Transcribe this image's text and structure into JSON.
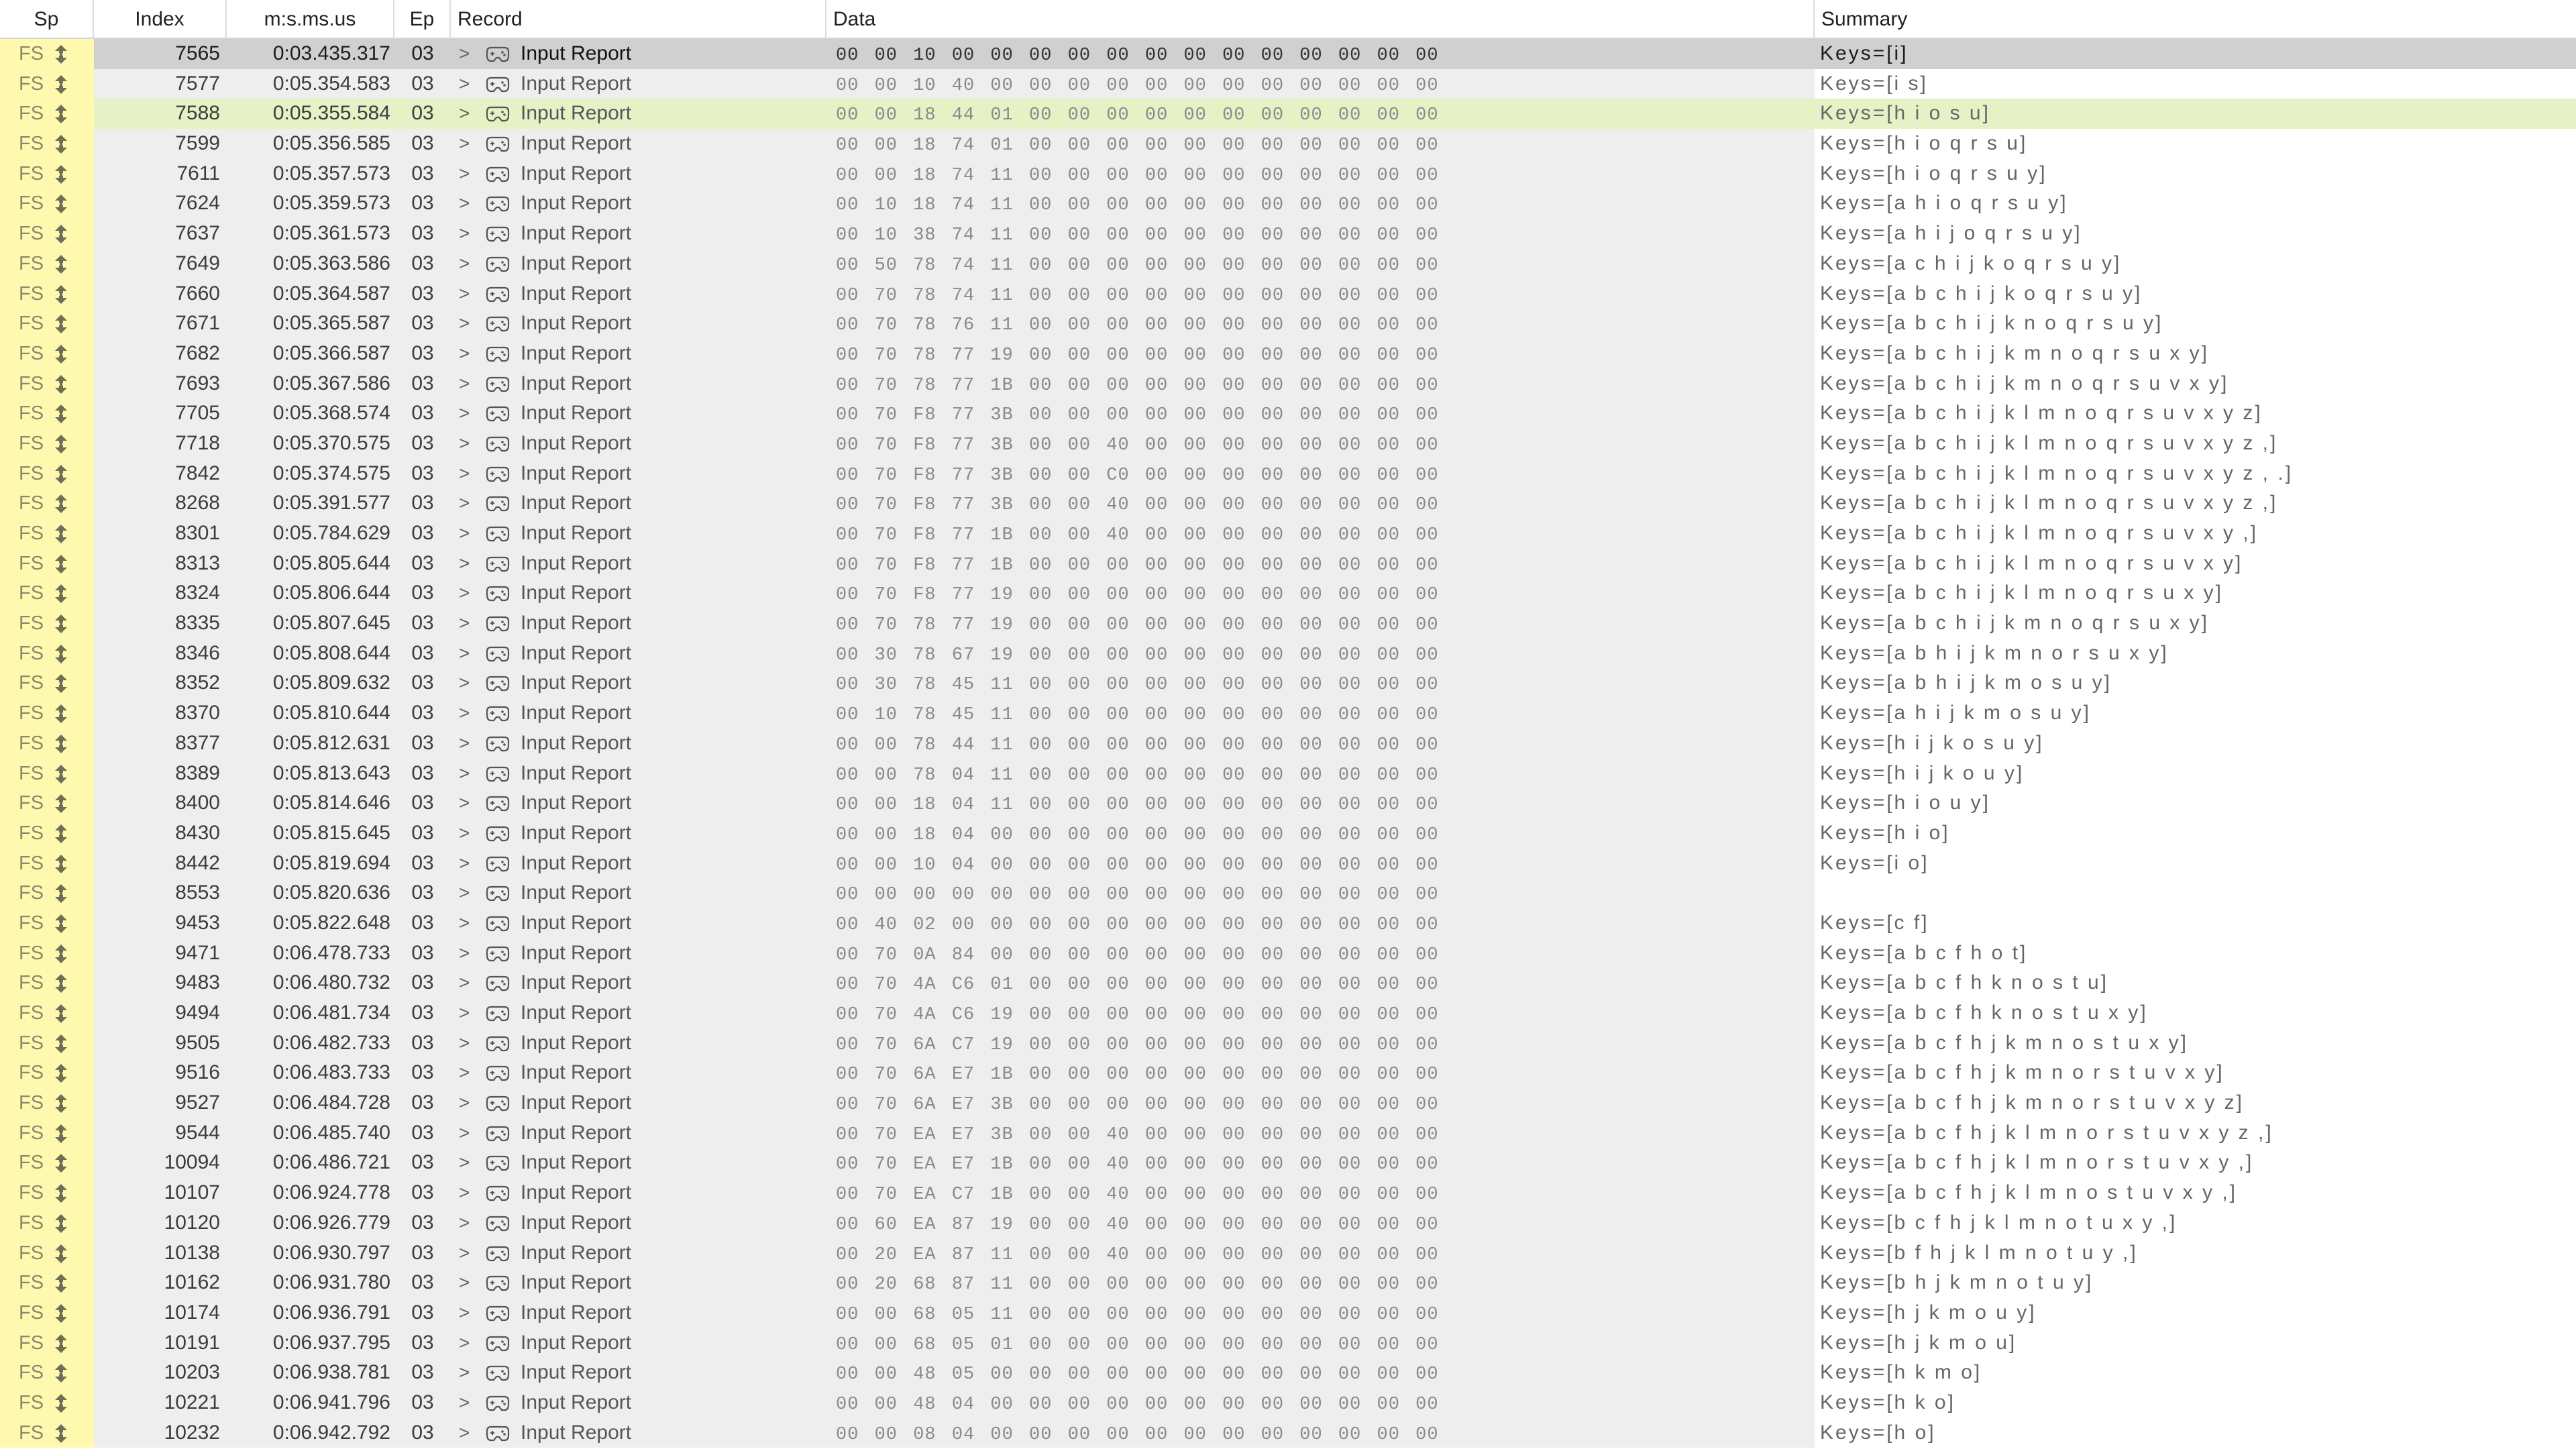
{
  "columns": {
    "sp": "Sp",
    "index": "Index",
    "time": "m:s.ms.us",
    "ep": "Ep",
    "record": "Record",
    "data": "Data",
    "summary": "Summary"
  },
  "icons": {
    "speed_arrow": "updown-arrow-icon",
    "expand": "chevron-right-icon",
    "record": "gamepad-icon"
  },
  "colors": {
    "sp_column": "#fff9b0",
    "selected_row": "#d0d0d0",
    "highlight_row": "#e6f2c6",
    "cell_bg": "#eeeeee"
  },
  "rows": [
    {
      "sp": "FS",
      "index": "7565",
      "time": "0:03.435.317",
      "ep": "03",
      "expand": ">",
      "record": "Input Report",
      "data": "00 00 10 00 00 00 00 00 00 00 00 00 00 00 00 00",
      "summary": "Keys=[i]",
      "state": "selected"
    },
    {
      "sp": "FS",
      "index": "7577",
      "time": "0:05.354.583",
      "ep": "03",
      "expand": ">",
      "record": "Input Report",
      "data": "00 00 10 40 00 00 00 00 00 00 00 00 00 00 00 00",
      "summary": "Keys=[i s]",
      "state": ""
    },
    {
      "sp": "FS",
      "index": "7588",
      "time": "0:05.355.584",
      "ep": "03",
      "expand": ">",
      "record": "Input Report",
      "data": "00 00 18 44 01 00 00 00 00 00 00 00 00 00 00 00",
      "summary": "Keys=[h i o s u]",
      "state": "highlight"
    },
    {
      "sp": "FS",
      "index": "7599",
      "time": "0:05.356.585",
      "ep": "03",
      "expand": ">",
      "record": "Input Report",
      "data": "00 00 18 74 01 00 00 00 00 00 00 00 00 00 00 00",
      "summary": "Keys=[h i o q r s u]",
      "state": ""
    },
    {
      "sp": "FS",
      "index": "7611",
      "time": "0:05.357.573",
      "ep": "03",
      "expand": ">",
      "record": "Input Report",
      "data": "00 00 18 74 11 00 00 00 00 00 00 00 00 00 00 00",
      "summary": "Keys=[h i o q r s u y]",
      "state": ""
    },
    {
      "sp": "FS",
      "index": "7624",
      "time": "0:05.359.573",
      "ep": "03",
      "expand": ">",
      "record": "Input Report",
      "data": "00 10 18 74 11 00 00 00 00 00 00 00 00 00 00 00",
      "summary": "Keys=[a h i o q r s u y]",
      "state": ""
    },
    {
      "sp": "FS",
      "index": "7637",
      "time": "0:05.361.573",
      "ep": "03",
      "expand": ">",
      "record": "Input Report",
      "data": "00 10 38 74 11 00 00 00 00 00 00 00 00 00 00 00",
      "summary": "Keys=[a h i j o q r s u y]",
      "state": ""
    },
    {
      "sp": "FS",
      "index": "7649",
      "time": "0:05.363.586",
      "ep": "03",
      "expand": ">",
      "record": "Input Report",
      "data": "00 50 78 74 11 00 00 00 00 00 00 00 00 00 00 00",
      "summary": "Keys=[a c h i j k o q r s u y]",
      "state": ""
    },
    {
      "sp": "FS",
      "index": "7660",
      "time": "0:05.364.587",
      "ep": "03",
      "expand": ">",
      "record": "Input Report",
      "data": "00 70 78 74 11 00 00 00 00 00 00 00 00 00 00 00",
      "summary": "Keys=[a b c h i j k o q r s u y]",
      "state": ""
    },
    {
      "sp": "FS",
      "index": "7671",
      "time": "0:05.365.587",
      "ep": "03",
      "expand": ">",
      "record": "Input Report",
      "data": "00 70 78 76 11 00 00 00 00 00 00 00 00 00 00 00",
      "summary": "Keys=[a b c h i j k n o q r s u y]",
      "state": ""
    },
    {
      "sp": "FS",
      "index": "7682",
      "time": "0:05.366.587",
      "ep": "03",
      "expand": ">",
      "record": "Input Report",
      "data": "00 70 78 77 19 00 00 00 00 00 00 00 00 00 00 00",
      "summary": "Keys=[a b c h i j k m n o q r s u x y]",
      "state": ""
    },
    {
      "sp": "FS",
      "index": "7693",
      "time": "0:05.367.586",
      "ep": "03",
      "expand": ">",
      "record": "Input Report",
      "data": "00 70 78 77 1B 00 00 00 00 00 00 00 00 00 00 00",
      "summary": "Keys=[a b c h i j k m n o q r s u v x y]",
      "state": ""
    },
    {
      "sp": "FS",
      "index": "7705",
      "time": "0:05.368.574",
      "ep": "03",
      "expand": ">",
      "record": "Input Report",
      "data": "00 70 F8 77 3B 00 00 00 00 00 00 00 00 00 00 00",
      "summary": "Keys=[a b c h i j k l m n o q r s u v x y z]",
      "state": ""
    },
    {
      "sp": "FS",
      "index": "7718",
      "time": "0:05.370.575",
      "ep": "03",
      "expand": ">",
      "record": "Input Report",
      "data": "00 70 F8 77 3B 00 00 40 00 00 00 00 00 00 00 00",
      "summary": "Keys=[a b c h i j k l m n o q r s u v x y z ,]",
      "state": ""
    },
    {
      "sp": "FS",
      "index": "7842",
      "time": "0:05.374.575",
      "ep": "03",
      "expand": ">",
      "record": "Input Report",
      "data": "00 70 F8 77 3B 00 00 C0 00 00 00 00 00 00 00 00",
      "summary": "Keys=[a b c h i j k l m n o q r s u v x y z , .]",
      "state": ""
    },
    {
      "sp": "FS",
      "index": "8268",
      "time": "0:05.391.577",
      "ep": "03",
      "expand": ">",
      "record": "Input Report",
      "data": "00 70 F8 77 3B 00 00 40 00 00 00 00 00 00 00 00",
      "summary": "Keys=[a b c h i j k l m n o q r s u v x y z ,]",
      "state": ""
    },
    {
      "sp": "FS",
      "index": "8301",
      "time": "0:05.784.629",
      "ep": "03",
      "expand": ">",
      "record": "Input Report",
      "data": "00 70 F8 77 1B 00 00 40 00 00 00 00 00 00 00 00",
      "summary": "Keys=[a b c h i j k l m n o q r s u v x y ,]",
      "state": ""
    },
    {
      "sp": "FS",
      "index": "8313",
      "time": "0:05.805.644",
      "ep": "03",
      "expand": ">",
      "record": "Input Report",
      "data": "00 70 F8 77 1B 00 00 00 00 00 00 00 00 00 00 00",
      "summary": "Keys=[a b c h i j k l m n o q r s u v x y]",
      "state": ""
    },
    {
      "sp": "FS",
      "index": "8324",
      "time": "0:05.806.644",
      "ep": "03",
      "expand": ">",
      "record": "Input Report",
      "data": "00 70 F8 77 19 00 00 00 00 00 00 00 00 00 00 00",
      "summary": "Keys=[a b c h i j k l m n o q r s u x y]",
      "state": ""
    },
    {
      "sp": "FS",
      "index": "8335",
      "time": "0:05.807.645",
      "ep": "03",
      "expand": ">",
      "record": "Input Report",
      "data": "00 70 78 77 19 00 00 00 00 00 00 00 00 00 00 00",
      "summary": "Keys=[a b c h i j k m n o q r s u x y]",
      "state": ""
    },
    {
      "sp": "FS",
      "index": "8346",
      "time": "0:05.808.644",
      "ep": "03",
      "expand": ">",
      "record": "Input Report",
      "data": "00 30 78 67 19 00 00 00 00 00 00 00 00 00 00 00",
      "summary": "Keys=[a b h i j k m n o r s u x y]",
      "state": ""
    },
    {
      "sp": "FS",
      "index": "8352",
      "time": "0:05.809.632",
      "ep": "03",
      "expand": ">",
      "record": "Input Report",
      "data": "00 30 78 45 11 00 00 00 00 00 00 00 00 00 00 00",
      "summary": "Keys=[a b h i j k m o s u y]",
      "state": ""
    },
    {
      "sp": "FS",
      "index": "8370",
      "time": "0:05.810.644",
      "ep": "03",
      "expand": ">",
      "record": "Input Report",
      "data": "00 10 78 45 11 00 00 00 00 00 00 00 00 00 00 00",
      "summary": "Keys=[a h i j k m o s u y]",
      "state": ""
    },
    {
      "sp": "FS",
      "index": "8377",
      "time": "0:05.812.631",
      "ep": "03",
      "expand": ">",
      "record": "Input Report",
      "data": "00 00 78 44 11 00 00 00 00 00 00 00 00 00 00 00",
      "summary": "Keys=[h i j k o s u y]",
      "state": ""
    },
    {
      "sp": "FS",
      "index": "8389",
      "time": "0:05.813.643",
      "ep": "03",
      "expand": ">",
      "record": "Input Report",
      "data": "00 00 78 04 11 00 00 00 00 00 00 00 00 00 00 00",
      "summary": "Keys=[h i j k o u y]",
      "state": ""
    },
    {
      "sp": "FS",
      "index": "8400",
      "time": "0:05.814.646",
      "ep": "03",
      "expand": ">",
      "record": "Input Report",
      "data": "00 00 18 04 11 00 00 00 00 00 00 00 00 00 00 00",
      "summary": "Keys=[h i o u y]",
      "state": ""
    },
    {
      "sp": "FS",
      "index": "8430",
      "time": "0:05.815.645",
      "ep": "03",
      "expand": ">",
      "record": "Input Report",
      "data": "00 00 18 04 00 00 00 00 00 00 00 00 00 00 00 00",
      "summary": "Keys=[h i o]",
      "state": ""
    },
    {
      "sp": "FS",
      "index": "8442",
      "time": "0:05.819.694",
      "ep": "03",
      "expand": ">",
      "record": "Input Report",
      "data": "00 00 10 04 00 00 00 00 00 00 00 00 00 00 00 00",
      "summary": "Keys=[i o]",
      "state": ""
    },
    {
      "sp": "FS",
      "index": "8553",
      "time": "0:05.820.636",
      "ep": "03",
      "expand": ">",
      "record": "Input Report",
      "data": "00 00 00 00 00 00 00 00 00 00 00 00 00 00 00 00",
      "summary": "",
      "state": ""
    },
    {
      "sp": "FS",
      "index": "9453",
      "time": "0:05.822.648",
      "ep": "03",
      "expand": ">",
      "record": "Input Report",
      "data": "00 40 02 00 00 00 00 00 00 00 00 00 00 00 00 00",
      "summary": "Keys=[c f]",
      "state": ""
    },
    {
      "sp": "FS",
      "index": "9471",
      "time": "0:06.478.733",
      "ep": "03",
      "expand": ">",
      "record": "Input Report",
      "data": "00 70 0A 84 00 00 00 00 00 00 00 00 00 00 00 00",
      "summary": "Keys=[a b c f h o t]",
      "state": ""
    },
    {
      "sp": "FS",
      "index": "9483",
      "time": "0:06.480.732",
      "ep": "03",
      "expand": ">",
      "record": "Input Report",
      "data": "00 70 4A C6 01 00 00 00 00 00 00 00 00 00 00 00",
      "summary": "Keys=[a b c f h k n o s t u]",
      "state": ""
    },
    {
      "sp": "FS",
      "index": "9494",
      "time": "0:06.481.734",
      "ep": "03",
      "expand": ">",
      "record": "Input Report",
      "data": "00 70 4A C6 19 00 00 00 00 00 00 00 00 00 00 00",
      "summary": "Keys=[a b c f h k n o s t u x y]",
      "state": ""
    },
    {
      "sp": "FS",
      "index": "9505",
      "time": "0:06.482.733",
      "ep": "03",
      "expand": ">",
      "record": "Input Report",
      "data": "00 70 6A C7 19 00 00 00 00 00 00 00 00 00 00 00",
      "summary": "Keys=[a b c f h j k m n o s t u x y]",
      "state": ""
    },
    {
      "sp": "FS",
      "index": "9516",
      "time": "0:06.483.733",
      "ep": "03",
      "expand": ">",
      "record": "Input Report",
      "data": "00 70 6A E7 1B 00 00 00 00 00 00 00 00 00 00 00",
      "summary": "Keys=[a b c f h j k m n o r s t u v x y]",
      "state": ""
    },
    {
      "sp": "FS",
      "index": "9527",
      "time": "0:06.484.728",
      "ep": "03",
      "expand": ">",
      "record": "Input Report",
      "data": "00 70 6A E7 3B 00 00 00 00 00 00 00 00 00 00 00",
      "summary": "Keys=[a b c f h j k m n o r s t u v x y z]",
      "state": ""
    },
    {
      "sp": "FS",
      "index": "9544",
      "time": "0:06.485.740",
      "ep": "03",
      "expand": ">",
      "record": "Input Report",
      "data": "00 70 EA E7 3B 00 00 40 00 00 00 00 00 00 00 00",
      "summary": "Keys=[a b c f h j k l m n o r s t u v x y z ,]",
      "state": ""
    },
    {
      "sp": "FS",
      "index": "10094",
      "time": "0:06.486.721",
      "ep": "03",
      "expand": ">",
      "record": "Input Report",
      "data": "00 70 EA E7 1B 00 00 40 00 00 00 00 00 00 00 00",
      "summary": "Keys=[a b c f h j k l m n o r s t u v x y ,]",
      "state": ""
    },
    {
      "sp": "FS",
      "index": "10107",
      "time": "0:06.924.778",
      "ep": "03",
      "expand": ">",
      "record": "Input Report",
      "data": "00 70 EA C7 1B 00 00 40 00 00 00 00 00 00 00 00",
      "summary": "Keys=[a b c f h j k l m n o s t u v x y ,]",
      "state": ""
    },
    {
      "sp": "FS",
      "index": "10120",
      "time": "0:06.926.779",
      "ep": "03",
      "expand": ">",
      "record": "Input Report",
      "data": "00 60 EA 87 19 00 00 40 00 00 00 00 00 00 00 00",
      "summary": "Keys=[b c f h j k l m n o t u x y ,]",
      "state": ""
    },
    {
      "sp": "FS",
      "index": "10138",
      "time": "0:06.930.797",
      "ep": "03",
      "expand": ">",
      "record": "Input Report",
      "data": "00 20 EA 87 11 00 00 40 00 00 00 00 00 00 00 00",
      "summary": "Keys=[b f h j k l m n o t u y ,]",
      "state": ""
    },
    {
      "sp": "FS",
      "index": "10162",
      "time": "0:06.931.780",
      "ep": "03",
      "expand": ">",
      "record": "Input Report",
      "data": "00 20 68 87 11 00 00 00 00 00 00 00 00 00 00 00",
      "summary": "Keys=[b h j k m n o t u y]",
      "state": ""
    },
    {
      "sp": "FS",
      "index": "10174",
      "time": "0:06.936.791",
      "ep": "03",
      "expand": ">",
      "record": "Input Report",
      "data": "00 00 68 05 11 00 00 00 00 00 00 00 00 00 00 00",
      "summary": "Keys=[h j k m o u y]",
      "state": ""
    },
    {
      "sp": "FS",
      "index": "10191",
      "time": "0:06.937.795",
      "ep": "03",
      "expand": ">",
      "record": "Input Report",
      "data": "00 00 68 05 01 00 00 00 00 00 00 00 00 00 00 00",
      "summary": "Keys=[h j k m o u]",
      "state": ""
    },
    {
      "sp": "FS",
      "index": "10203",
      "time": "0:06.938.781",
      "ep": "03",
      "expand": ">",
      "record": "Input Report",
      "data": "00 00 48 05 00 00 00 00 00 00 00 00 00 00 00 00",
      "summary": "Keys=[h k m o]",
      "state": ""
    },
    {
      "sp": "FS",
      "index": "10221",
      "time": "0:06.941.796",
      "ep": "03",
      "expand": ">",
      "record": "Input Report",
      "data": "00 00 48 04 00 00 00 00 00 00 00 00 00 00 00 00",
      "summary": "Keys=[h k o]",
      "state": ""
    },
    {
      "sp": "FS",
      "index": "10232",
      "time": "0:06.942.792",
      "ep": "03",
      "expand": ">",
      "record": "Input Report",
      "data": "00 00 08 04 00 00 00 00 00 00 00 00 00 00 00 00",
      "summary": "Keys=[h o]",
      "state": ""
    }
  ]
}
